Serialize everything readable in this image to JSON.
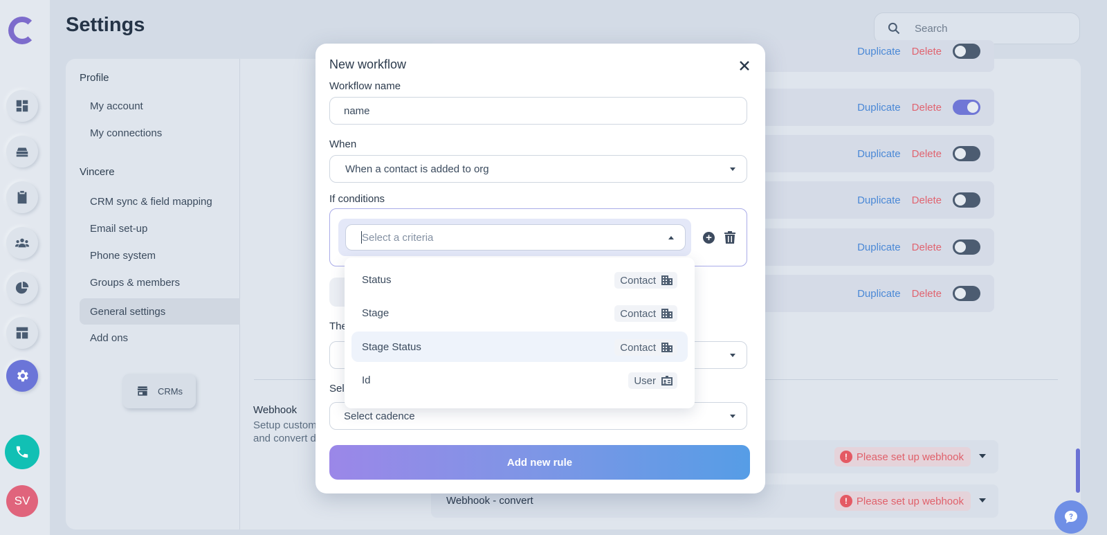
{
  "app": {
    "page_title": "Settings",
    "search_placeholder": "Search",
    "avatar_initials": "SV"
  },
  "settings_nav": {
    "sections": [
      {
        "heading": "Profile",
        "items": [
          "My account",
          "My connections"
        ]
      },
      {
        "heading": "Vincere",
        "items": [
          "CRM sync & field mapping",
          "Email set-up",
          "Phone system",
          "Groups & members",
          "General settings",
          "Add ons"
        ]
      }
    ],
    "active_item": "General settings",
    "crms_button": "CRMs"
  },
  "workflows": {
    "duplicate_label": "Duplicate",
    "delete_label": "Delete",
    "toggles": [
      false,
      true,
      false,
      false,
      false,
      false
    ]
  },
  "webhook": {
    "title": "Webhook",
    "description_line1": "Setup custom",
    "description_line2": "and convert d",
    "rows": [
      {
        "name": "",
        "warning": "Please set up webhook"
      },
      {
        "name": "Webhook - convert",
        "warning": "Please set up webhook"
      }
    ]
  },
  "modal": {
    "title": "New workflow",
    "workflow_name_label": "Workflow name",
    "workflow_name_value": "name",
    "when_label": "When",
    "when_value": "When a contact is added to org",
    "if_label": "If conditions",
    "criteria_placeholder": "Select a criteria",
    "then_label_partial": "The",
    "select_label_partial": "Sel",
    "cadence_placeholder": "Select cadence",
    "submit_label": "Add new rule"
  },
  "criteria_dropdown": {
    "options": [
      {
        "label": "Status",
        "entity": "Contact",
        "icon": "building-icon"
      },
      {
        "label": "Stage",
        "entity": "Contact",
        "icon": "building-icon"
      },
      {
        "label": "Stage Status",
        "entity": "Contact",
        "icon": "building-icon",
        "highlighted": true
      },
      {
        "label": "Id",
        "entity": "User",
        "icon": "id-card-icon"
      }
    ]
  },
  "colors": {
    "accent": "#6b75d8",
    "delete": "#e06470",
    "duplicate": "#4a88d6",
    "warning": "#e0606a",
    "phone": "#11c0b4"
  }
}
